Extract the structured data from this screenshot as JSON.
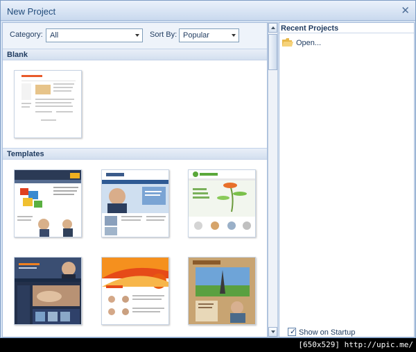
{
  "window": {
    "title": "New Project",
    "close_glyph": "✕"
  },
  "filters": {
    "category_label": "Category:",
    "category_value": "All",
    "sort_label": "Sort By:",
    "sort_value": "Popular"
  },
  "sections": {
    "blank": "Blank",
    "templates": "Templates"
  },
  "recent": {
    "title": "Recent Projects",
    "open_label": "Open...",
    "show_on_startup": "Show on Startup",
    "show_on_startup_checked": true
  },
  "footer": {
    "text": "[650x529] http://upic.me/"
  },
  "colors": {
    "accent": "#1e3a5f",
    "titlebar": "#c9d9ee",
    "border": "#7d9cc4"
  }
}
